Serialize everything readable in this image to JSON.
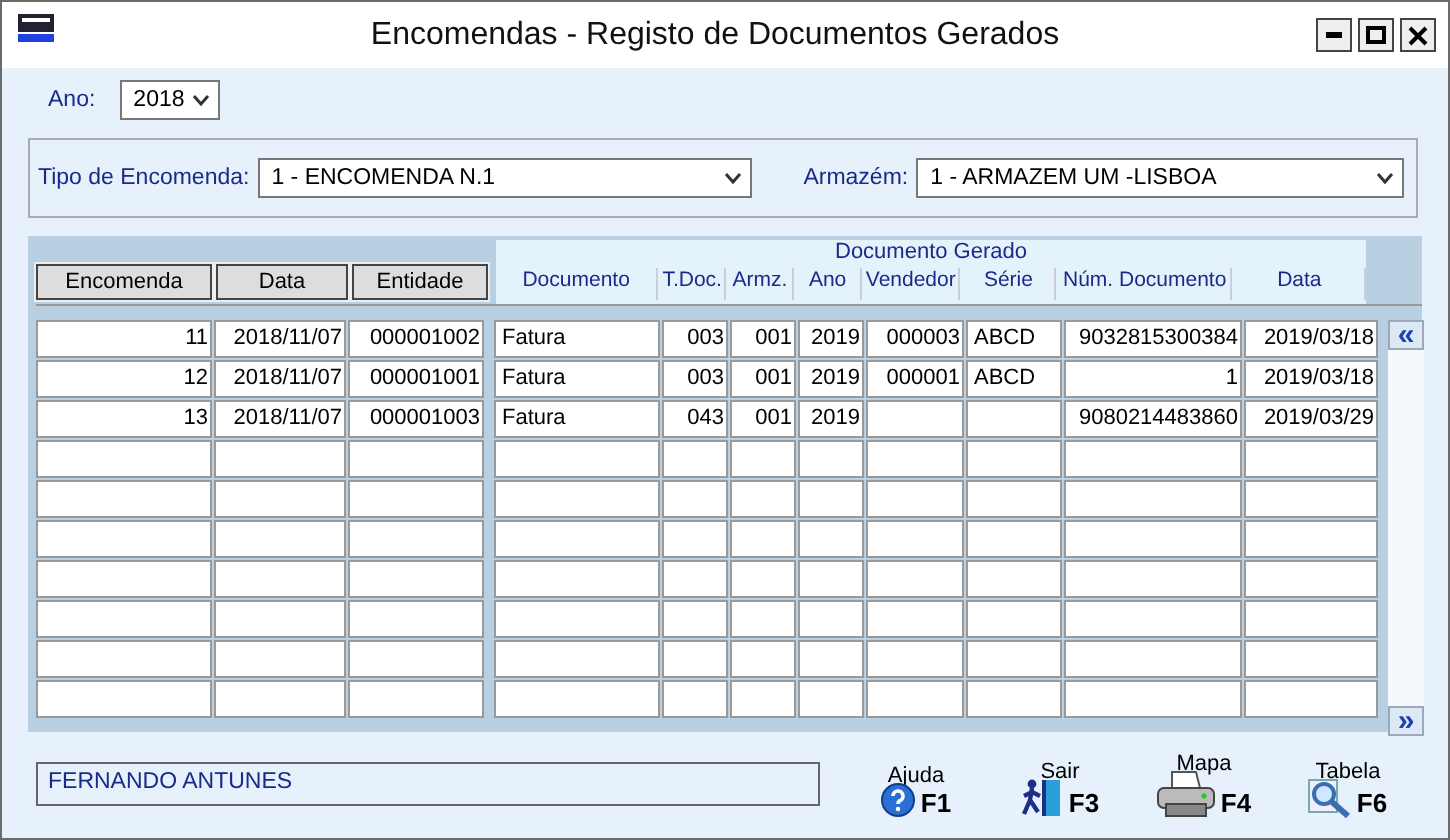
{
  "window": {
    "title": "Encomendas - Registo de Documentos Gerados"
  },
  "ano": {
    "label": "Ano:",
    "value": "2018"
  },
  "filters": [
    {
      "label": "Tipo de Encomenda:",
      "value": "1 - ENCOMENDA N.1"
    },
    {
      "label": "Armazém:",
      "value": "1 - ARMAZEM UM -LISBOA"
    }
  ],
  "table": {
    "group_heading": "Documento Gerado",
    "columns": [
      {
        "label": "Encomenda",
        "kind": "button"
      },
      {
        "label": "Data",
        "kind": "button"
      },
      {
        "label": "Entidade",
        "kind": "button"
      },
      {
        "label": "Documento",
        "kind": "plain"
      },
      {
        "label": "T.Doc.",
        "kind": "plain"
      },
      {
        "label": "Armz.",
        "kind": "plain"
      },
      {
        "label": "Ano",
        "kind": "plain"
      },
      {
        "label": "Vendedor",
        "kind": "plain"
      },
      {
        "label": "Série",
        "kind": "plain"
      },
      {
        "label": "Núm. Documento",
        "kind": "plain"
      },
      {
        "label": "Data",
        "kind": "plain"
      }
    ],
    "rows": [
      [
        "11",
        "2018/11/07",
        "000001002",
        "Fatura",
        "003",
        "001",
        "2019",
        "000003",
        "ABCD",
        "9032815300384",
        "2019/03/18"
      ],
      [
        "12",
        "2018/11/07",
        "000001001",
        "Fatura",
        "003",
        "001",
        "2019",
        "000001",
        "ABCD",
        "1",
        "2019/03/18"
      ],
      [
        "13",
        "2018/11/07",
        "000001003",
        "Fatura",
        "043",
        "001",
        "2019",
        null,
        null,
        "9080214483860",
        "2019/03/29"
      ]
    ],
    "scroll_up": "«",
    "scroll_down": "»"
  },
  "status_text": "FERNANDO ANTUNES",
  "actions": [
    {
      "kind": "help",
      "label": "Ajuda",
      "key": "F1"
    },
    {
      "kind": "exit",
      "label": "Sair",
      "key": "F3"
    },
    {
      "kind": "print",
      "label": "Mapa",
      "key": "F4"
    },
    {
      "kind": "search",
      "label": "Tabela",
      "key": "F6"
    }
  ]
}
